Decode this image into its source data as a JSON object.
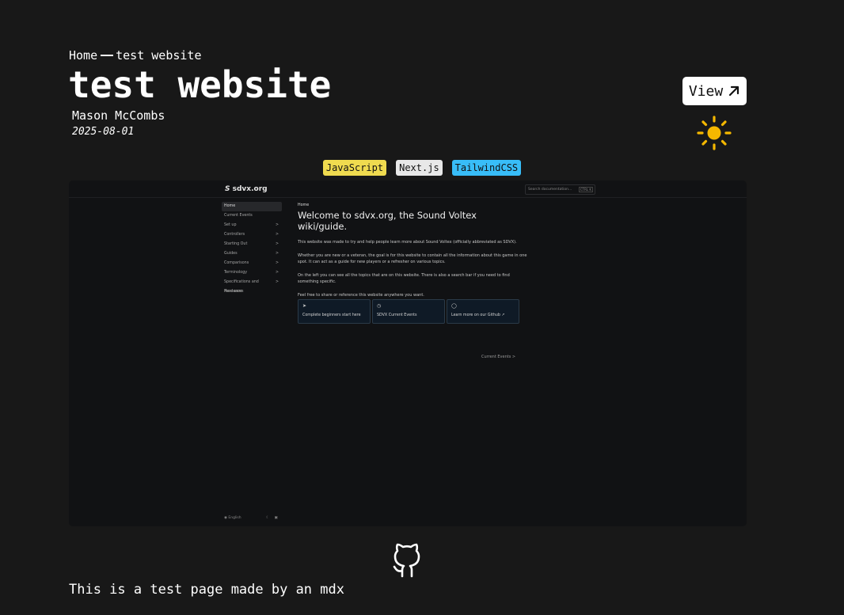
{
  "breadcrumb": {
    "home": "Home",
    "current": "test website"
  },
  "title": "test website",
  "author": "Mason McCombs",
  "date": "2025-08-01",
  "view_button": {
    "label": "View",
    "icon": "arrow-up-right-icon"
  },
  "theme_toggle": {
    "icon": "sun-icon",
    "color": "#f5b800"
  },
  "tags": [
    {
      "label": "JavaScript",
      "color": "#f0db4f"
    },
    {
      "label": "Next.js",
      "color": "#e8e8e8"
    },
    {
      "label": "TailwindCSS",
      "color": "#38bdf8"
    }
  ],
  "preview": {
    "logo": "sdvx.org",
    "search_placeholder": "Search documentation...",
    "search_kbd": "CTRL K",
    "sidebar": [
      {
        "label": "Home",
        "chevron": ""
      },
      {
        "label": "Current Events",
        "chevron": ""
      },
      {
        "label": "Set up",
        "chevron": ">"
      },
      {
        "label": "Controllers",
        "chevron": ">"
      },
      {
        "label": "Starting Out",
        "chevron": ">"
      },
      {
        "label": "Guides",
        "chevron": ">"
      },
      {
        "label": "Comparisons",
        "chevron": ">"
      },
      {
        "label": "Terminology",
        "chevron": ">"
      },
      {
        "label": "Specifications and Hardware",
        "chevron": ">"
      },
      {
        "label": "Resources",
        "chevron": ""
      }
    ],
    "crumb": "Home",
    "heading": "Welcome to sdvx.org, the Sound Voltex wiki/guide.",
    "paragraphs": [
      "This website was made to try and help people learn more about Sound Voltex (officially abbreviated as SDVX).",
      "Whether you are new or a veteran, the goal is for this website to contain all the information about this game in one spot. It can act as a guide for new players or a refresher on various topics.",
      "On the left you can see all the topics that are on this website. There is also a search bar if you need to find something specific.",
      "Feel free to share or reference this website anywhere you want."
    ],
    "cards": [
      {
        "icon": "rocket-icon",
        "label": "Complete beginners start here"
      },
      {
        "icon": "clock-icon",
        "label": "SDVX Current Events"
      },
      {
        "icon": "github-icon",
        "label": "Learn more on our Github ↗"
      }
    ],
    "next_link": "Current Events  >",
    "footer_lang": "English"
  },
  "github_link": {
    "icon": "github-icon"
  },
  "body_text": "This is a test page made by an mdx"
}
